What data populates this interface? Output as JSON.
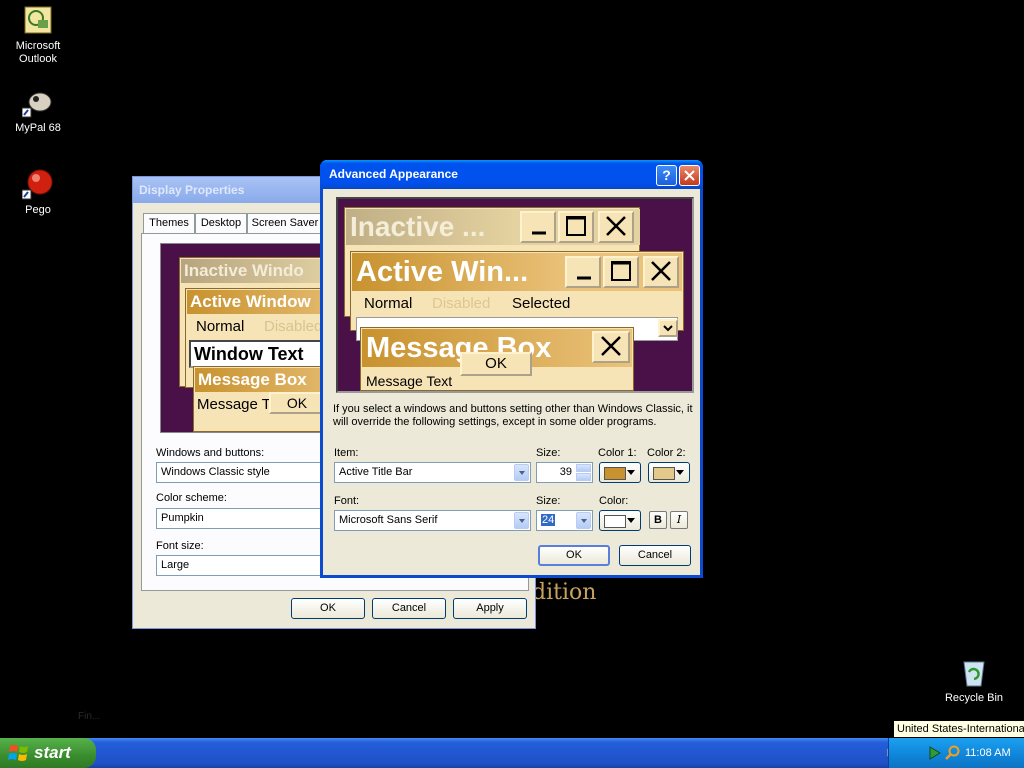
{
  "desktop": {
    "icons": [
      {
        "label": "Microsoft Outlook",
        "icon": "outlook-icon"
      },
      {
        "label": "MyPal 68",
        "icon": "mypal-icon"
      },
      {
        "label": "Pego",
        "icon": "pego-icon"
      },
      {
        "label": "Recycle Bin",
        "icon": "recycle-bin-icon"
      }
    ],
    "wallpaper_text": "dition",
    "wallpaper_small": "Fin..."
  },
  "display_properties": {
    "title": "Display Properties",
    "tabs": [
      "Themes",
      "Desktop",
      "Screen Saver"
    ],
    "preview": {
      "inactive_title": "Inactive Windo",
      "active_title": "Active Window",
      "normal": "Normal",
      "disabled": "Disabled",
      "window_text": "Window Text",
      "message_box": "Message Box",
      "message_text": "Message T",
      "ok": "OK"
    },
    "windows_buttons_label": "Windows and buttons:",
    "windows_buttons_value": "Windows Classic style",
    "color_scheme_label": "Color scheme:",
    "color_scheme_value": "Pumpkin",
    "font_size_label": "Font size:",
    "font_size_value": "Large",
    "ok": "OK",
    "cancel": "Cancel",
    "apply": "Apply"
  },
  "advanced": {
    "title": "Advanced Appearance",
    "preview": {
      "inactive_title": "Inactive ...",
      "active_title": "Active Win...",
      "normal": "Normal",
      "disabled": "Disabled",
      "selected": "Selected",
      "message_box": "Message Box",
      "message_text": "Message Text",
      "ok": "OK"
    },
    "info": "If you select a windows and buttons setting other than Windows Classic, it will override the following settings, except in some older programs.",
    "item_label": "Item:",
    "item_value": "Active Title Bar",
    "size_label": "Size:",
    "size_value": "39",
    "color1_label": "Color 1:",
    "color2_label": "Color 2:",
    "font_label": "Font:",
    "font_value": "Microsoft Sans Serif",
    "font_size_label": "Size:",
    "font_size_value": "24",
    "color_label": "Color:",
    "bold": "B",
    "italic": "I",
    "ok": "OK",
    "cancel": "Cancel",
    "color1": "#c8922e",
    "color2": "#e3c98a",
    "font_color": "#ffffff"
  },
  "taskbar": {
    "start": "start",
    "tooltip": "United States-International",
    "clock": "11:08 AM"
  },
  "colors": {
    "xp_blue": "#0a5fd8",
    "preview_bg": "#4a1048",
    "pumpkin_title": "#c8922e",
    "pumpkin_face": "#f6e4b6"
  }
}
